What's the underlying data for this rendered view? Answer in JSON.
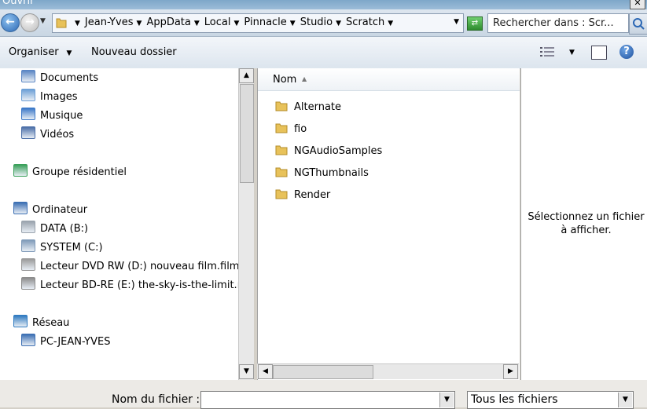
{
  "window": {
    "title": "Ouvrir",
    "close_glyph": "✕"
  },
  "address": {
    "crumbs": [
      "Jean-Yves",
      "AppData",
      "Local",
      "Pinnacle",
      "Studio",
      "Scratch"
    ],
    "search_placeholder": "Rechercher dans : Scr..."
  },
  "toolbar": {
    "organize": "Organiser",
    "new_folder": "Nouveau dossier",
    "help_glyph": "?"
  },
  "nav": {
    "items": [
      {
        "label": "Documents",
        "icon": "documents-icon",
        "color": "#5a86c4"
      },
      {
        "label": "Images",
        "icon": "pictures-icon",
        "color": "#6c9fd6"
      },
      {
        "label": "Musique",
        "icon": "music-icon",
        "color": "#3b78c8"
      },
      {
        "label": "Vidéos",
        "icon": "videos-icon",
        "color": "#4b6ea8"
      },
      {
        "label": "Groupe résidentiel",
        "icon": "homegroup-icon",
        "color": "#3aa05a"
      },
      {
        "label": "Ordinateur",
        "icon": "computer-icon",
        "color": "#3c6fb3"
      },
      {
        "label": "DATA (B:)",
        "icon": "drive-icon",
        "color": "#9aa3ad"
      },
      {
        "label": "SYSTEM (C:)",
        "icon": "system-drive-icon",
        "color": "#7f9ab8"
      },
      {
        "label": "Lecteur DVD RW (D:) nouveau film.film",
        "icon": "dvd-icon",
        "color": "#9a9a9a"
      },
      {
        "label": "Lecteur BD-RE (E:) the-sky-is-the-limit.m",
        "icon": "bd-icon",
        "color": "#8c8c8c"
      },
      {
        "label": "Réseau",
        "icon": "network-icon",
        "color": "#2f7ac0"
      },
      {
        "label": "PC-JEAN-YVES",
        "icon": "pc-icon",
        "color": "#3c6fb3"
      }
    ]
  },
  "files": {
    "column": "Nom",
    "items": [
      "Alternate",
      "fio",
      "NGAudioSamples",
      "NGThumbnails",
      "Render"
    ]
  },
  "preview": {
    "text": "Sélectionnez un fichier à afficher."
  },
  "bottom": {
    "filename_label": "Nom du fichier :",
    "filename_value": "",
    "filetype": "Tous les fichiers"
  },
  "colors": {
    "folder": "#e8c25a",
    "accent": "#2b67b4"
  }
}
